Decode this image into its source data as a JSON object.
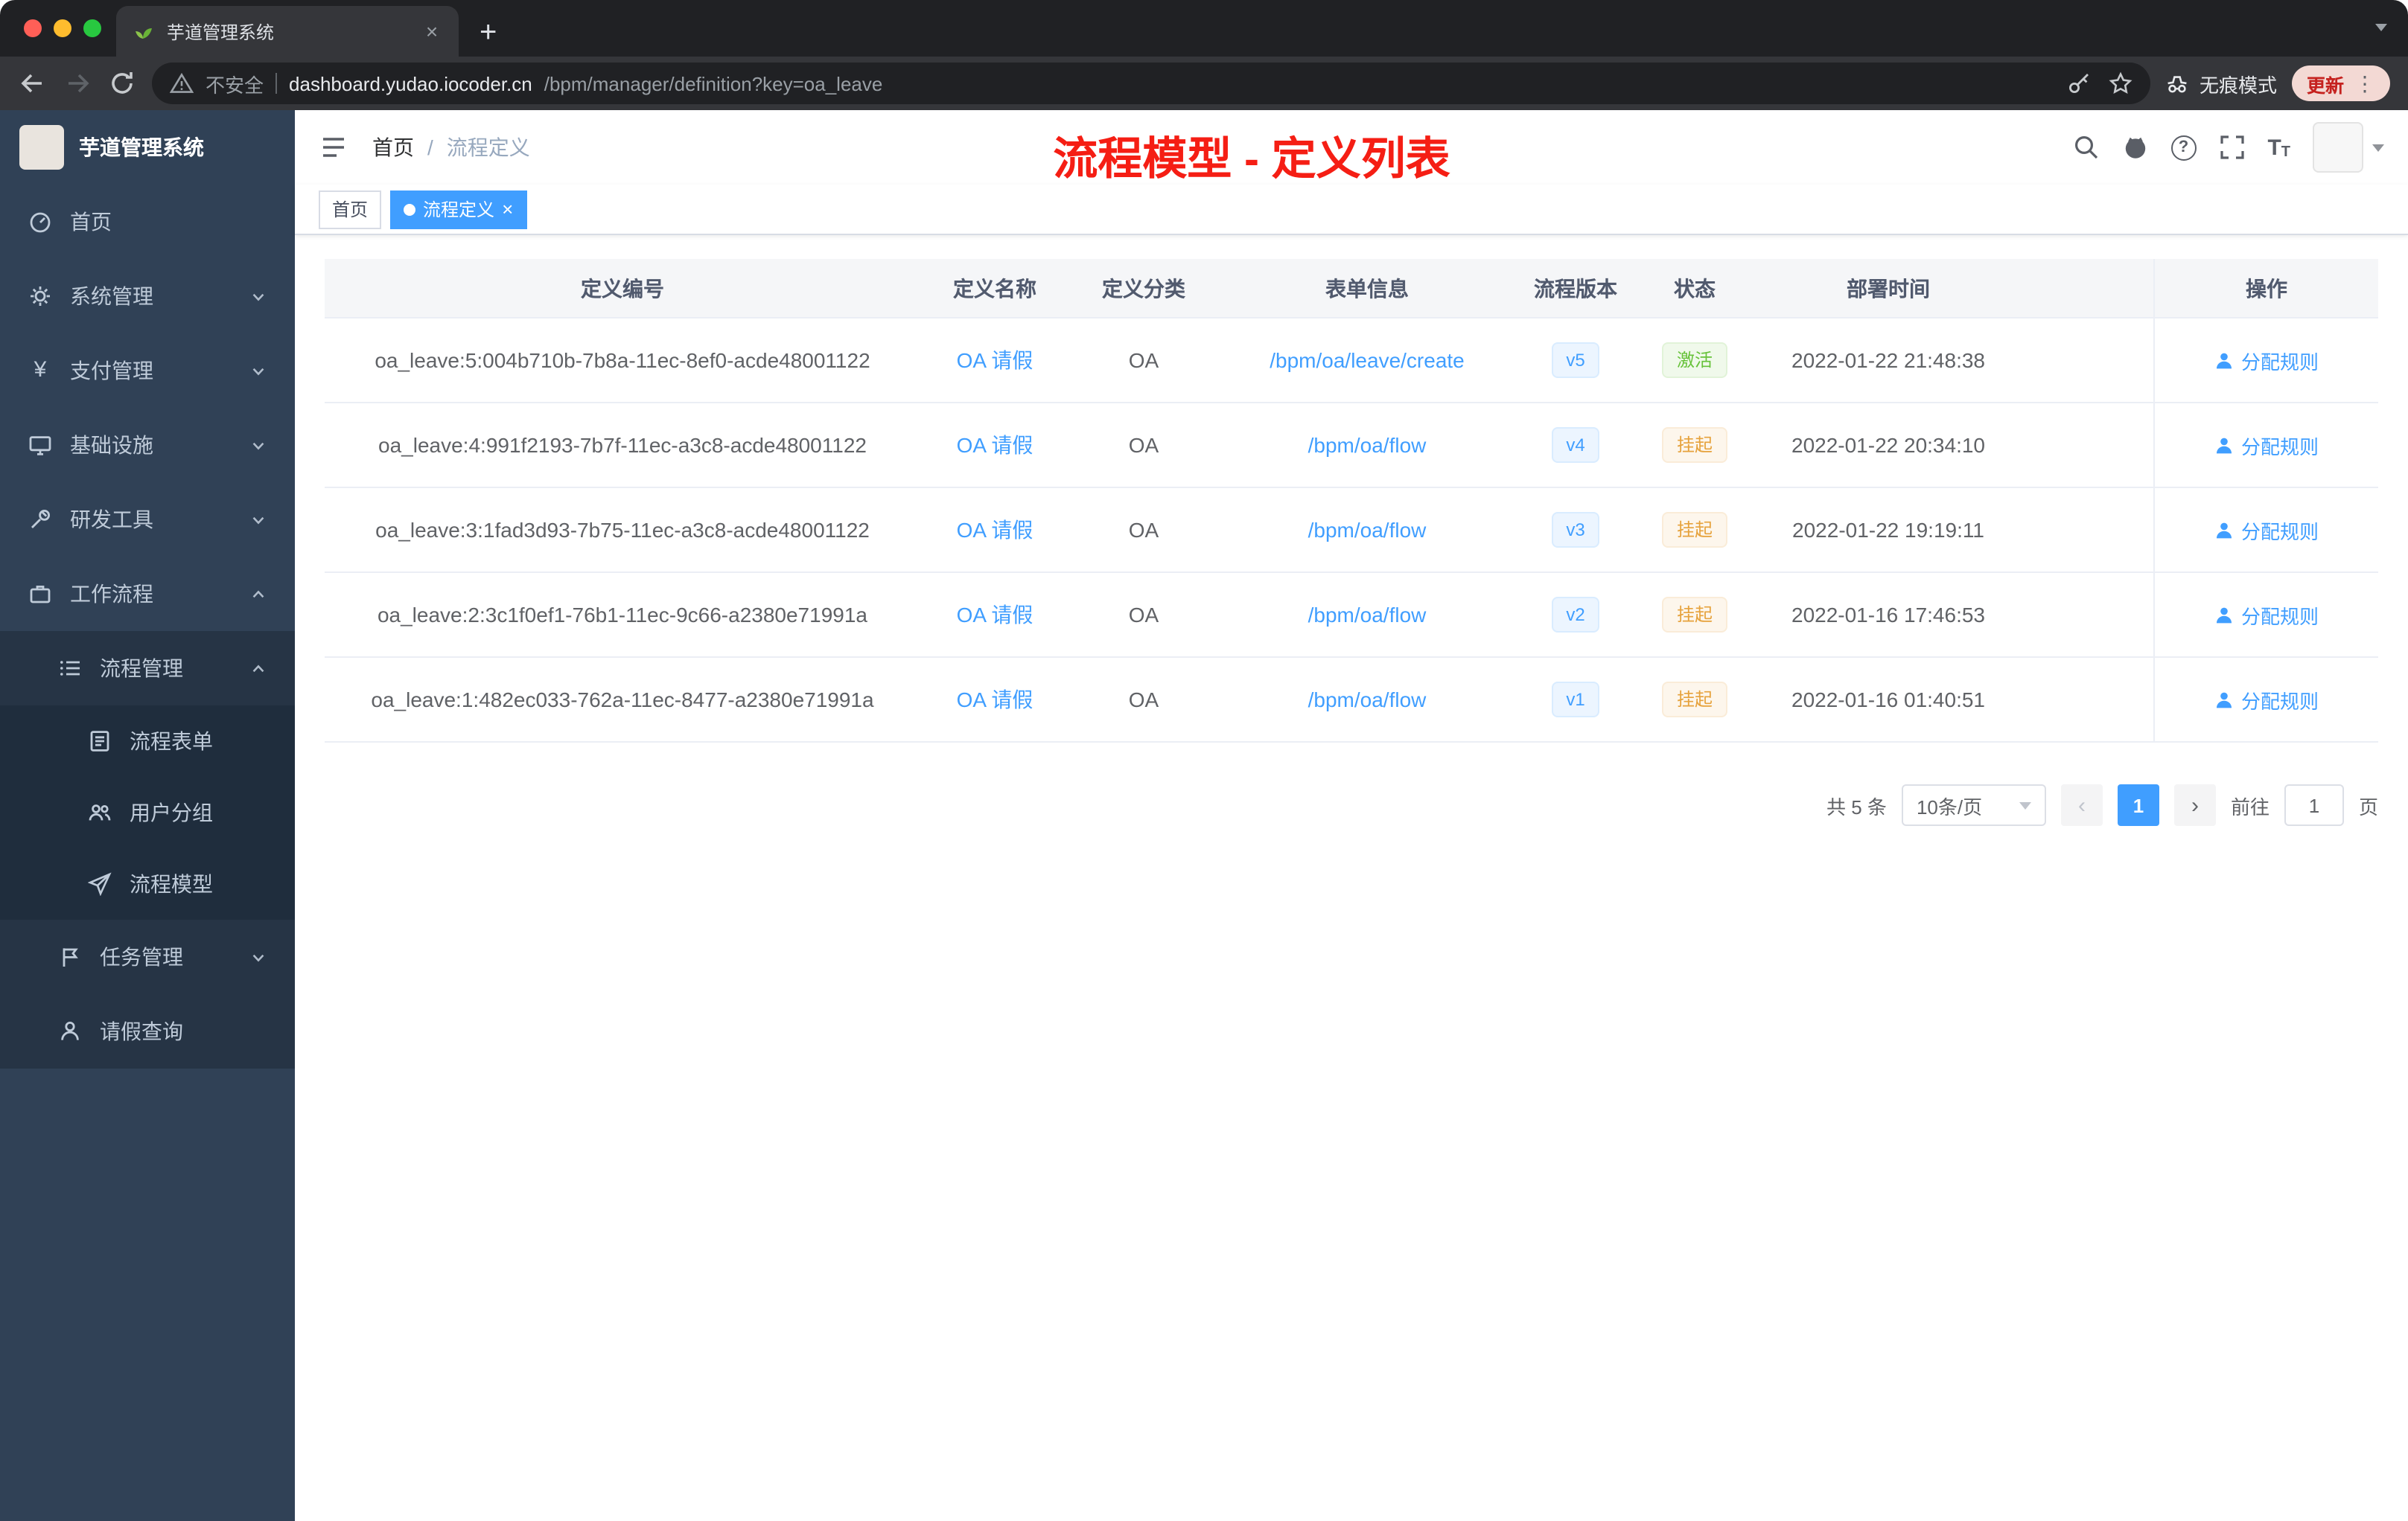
{
  "colors": {
    "accent": "#409eff",
    "success": "#67c23a",
    "warning": "#e6a23c",
    "annotation_red": "#f51e14",
    "sidebar_bg": "#304156"
  },
  "icons": {
    "close": "×",
    "plus": "+",
    "kebab": "⋮",
    "prev": "‹",
    "next": "›",
    "question": "?",
    "yen": "¥",
    "slash": "/",
    "font_large": "T",
    "font_small": "T"
  },
  "browser": {
    "tab": {
      "title": "芋道管理系统"
    },
    "address": {
      "security_label": "不安全",
      "url_host": "dashboard.yudao.iocoder.cn",
      "url_path": "/bpm/manager/definition?key=oa_leave"
    },
    "incognito_label": "无痕模式",
    "update_label": "更新"
  },
  "sidebar": {
    "logo_title": "芋道管理系统",
    "menu": [
      {
        "label": "首页"
      },
      {
        "label": "系统管理"
      },
      {
        "label": "支付管理"
      },
      {
        "label": "基础设施"
      },
      {
        "label": "研发工具"
      },
      {
        "label": "工作流程"
      }
    ],
    "process_group": {
      "label": "流程管理"
    },
    "process_children": [
      {
        "label": "流程表单"
      },
      {
        "label": "用户分组"
      },
      {
        "label": "流程模型"
      }
    ],
    "task_group": {
      "label": "任务管理"
    },
    "leave_item": {
      "label": "请假查询"
    }
  },
  "navbar": {
    "breadcrumb": {
      "home": "首页",
      "current": "流程定义"
    },
    "annotation": "流程模型 - 定义列表"
  },
  "tags": {
    "home": "首页",
    "active": "流程定义"
  },
  "table": {
    "headers": {
      "id": "定义编号",
      "name": "定义名称",
      "category": "定义分类",
      "form": "表单信息",
      "version": "流程版本",
      "status": "状态",
      "deploy_time": "部署时间",
      "action": "操作"
    },
    "rows": [
      {
        "id": "oa_leave:5:004b710b-7b8a-11ec-8ef0-acde48001122",
        "name": "OA 请假",
        "category": "OA",
        "form": "/bpm/oa/leave/create",
        "version": "v5",
        "status": "激活",
        "deploy_time": "2022-01-22 21:48:38",
        "action": "分配规则"
      },
      {
        "id": "oa_leave:4:991f2193-7b7f-11ec-a3c8-acde48001122",
        "name": "OA 请假",
        "category": "OA",
        "form": "/bpm/oa/flow",
        "version": "v4",
        "status": "挂起",
        "deploy_time": "2022-01-22 20:34:10",
        "action": "分配规则"
      },
      {
        "id": "oa_leave:3:1fad3d93-7b75-11ec-a3c8-acde48001122",
        "name": "OA 请假",
        "category": "OA",
        "form": "/bpm/oa/flow",
        "version": "v3",
        "status": "挂起",
        "deploy_time": "2022-01-22 19:19:11",
        "action": "分配规则"
      },
      {
        "id": "oa_leave:2:3c1f0ef1-76b1-11ec-9c66-a2380e71991a",
        "name": "OA 请假",
        "category": "OA",
        "form": "/bpm/oa/flow",
        "version": "v2",
        "status": "挂起",
        "deploy_time": "2022-01-16 17:46:53",
        "action": "分配规则"
      },
      {
        "id": "oa_leave:1:482ec033-762a-11ec-8477-a2380e71991a",
        "name": "OA 请假",
        "category": "OA",
        "form": "/bpm/oa/flow",
        "version": "v1",
        "status": "挂起",
        "deploy_time": "2022-01-16 01:40:51",
        "action": "分配规则"
      }
    ]
  },
  "pagination": {
    "total": "共 5 条",
    "page_size": "10条/页",
    "current_page": "1",
    "goto_label": "前往",
    "goto_value": "1",
    "page_unit": "页"
  }
}
